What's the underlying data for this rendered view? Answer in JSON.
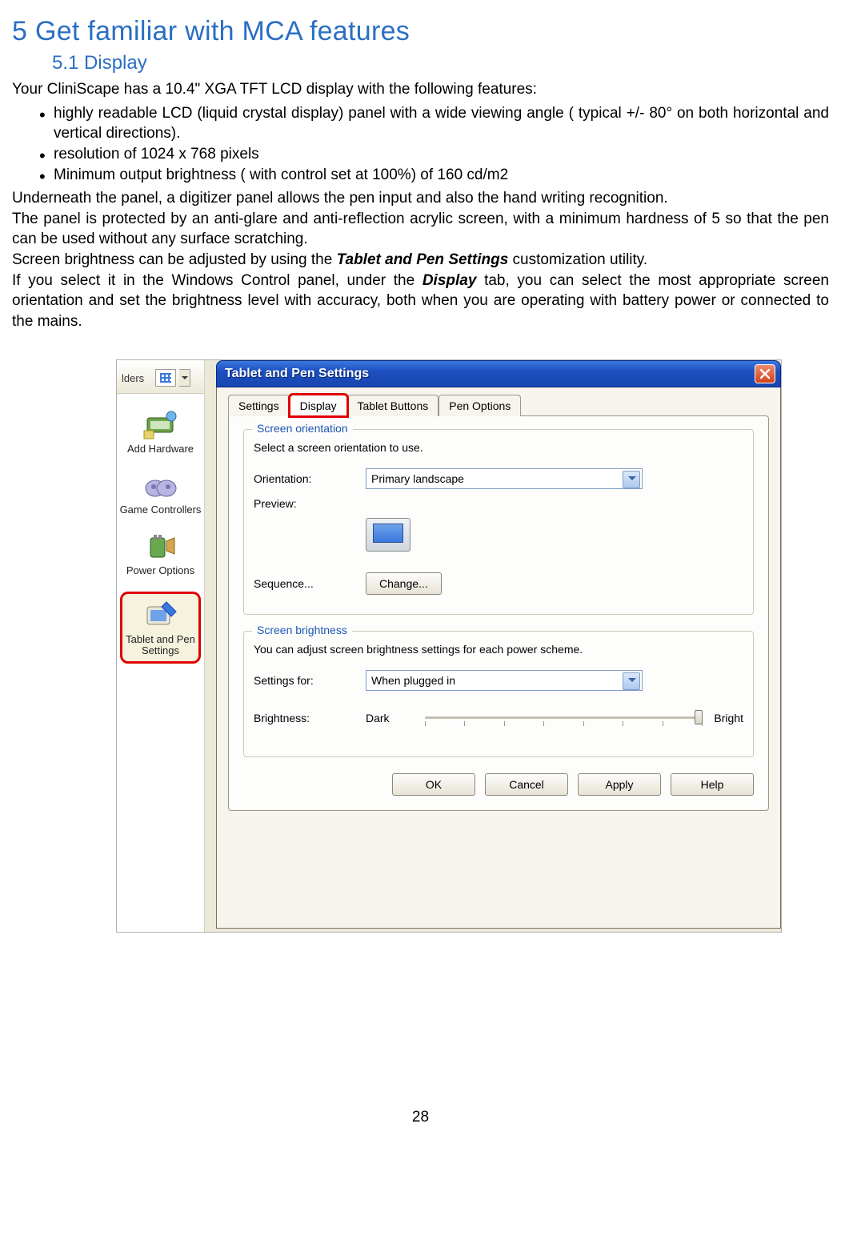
{
  "heading": {
    "h1": "5  Get familiar with MCA features",
    "h2": "5.1   Display"
  },
  "intro": "Your CliniScape has a 10.4\" XGA TFT LCD display with the following features:",
  "bullets": [
    "highly readable LCD (liquid crystal display) panel  with a wide viewing angle (  typical  +/- 80° on both horizontal and vertical directions).",
    "resolution of  1024 x 768 pixels",
    "Minimum output brightness ( with control set at 100%) of 160 cd/m2"
  ],
  "paragraphs": {
    "p1": "Underneath the panel, a digitizer panel allows the pen input and also the hand writing recognition.",
    "p2": "The panel is protected by an anti-glare and anti-reflection acrylic screen, with a minimum hardness of 5 so that the pen can be used without any surface scratching.",
    "p3a": "Screen brightness can be adjusted by using the ",
    "p3b_bold": "Tablet and Pen Settings",
    "p3c": " customization utility.",
    "p4a": "If you select it in the Windows Control panel, under the ",
    "p4b_bold": "Display",
    "p4c": " tab, you can select the most appropriate screen orientation  and set  the brightness level with accuracy, both when you are operating with battery power or connected to the mains."
  },
  "pagenum": "28",
  "sidebar": {
    "toolbar_text": "lders",
    "items": [
      {
        "label": "Add Hardware"
      },
      {
        "label": "Game Controllers"
      },
      {
        "label": "Power Options"
      },
      {
        "label": "Tablet and Pen Settings"
      }
    ]
  },
  "window": {
    "title": "Tablet and Pen Settings",
    "tabs": [
      "Settings",
      "Display",
      "Tablet Buttons",
      "Pen Options"
    ],
    "active_tab": "Display",
    "group1": {
      "title": "Screen orientation",
      "desc": "Select a screen orientation to use.",
      "orientation_label": "Orientation:",
      "orientation_value": "Primary landscape",
      "preview_label": "Preview:",
      "sequence_label": "Sequence...",
      "change_btn": "Change..."
    },
    "group2": {
      "title": "Screen brightness",
      "desc": "You can adjust screen brightness settings for each power scheme.",
      "settings_for_label": "Settings for:",
      "settings_for_value": "When plugged in",
      "brightness_label": "Brightness:",
      "dark": "Dark",
      "bright": "Bright"
    },
    "buttons": {
      "ok": "OK",
      "cancel": "Cancel",
      "apply": "Apply",
      "help": "Help"
    }
  }
}
